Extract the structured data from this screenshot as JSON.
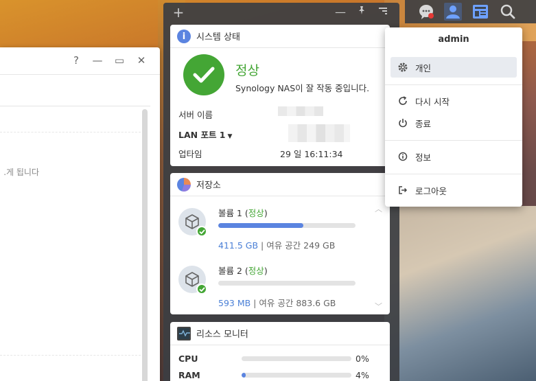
{
  "app_window": {
    "controls": {
      "help": "?",
      "minimize": "—",
      "maximize": "▭",
      "close": "✕"
    },
    "partial_text": "게 됩니다."
  },
  "widget_panel": {
    "toolbar": {
      "add": "+",
      "minimize": "—",
      "pin": "📌",
      "menu": "☰"
    },
    "system_status": {
      "title": "시스템 상태",
      "status": "정상",
      "description": "Synology NAS이 잘 작동 중입니다.",
      "server_name_label": "서버 이름",
      "lan_port_label": "LAN 포트 1",
      "uptime_label": "업타임",
      "uptime_value": "29 일 16:11:34"
    },
    "storage": {
      "title": "저장소",
      "volumes": [
        {
          "name": "볼륨 1",
          "state": "정상",
          "used": "411.5 GB",
          "free_label": "여유 공간",
          "free": "249 GB",
          "usage_fraction": 0.62
        },
        {
          "name": "볼륨 2",
          "state": "정상",
          "used": "593 MB",
          "free_label": "여유 공간",
          "free": "883.6 GB",
          "usage_fraction": 0.0
        }
      ]
    },
    "resource_monitor": {
      "title": "리소스 모니터",
      "rows": [
        {
          "label": "CPU",
          "value": "0%",
          "fraction": 0.0
        },
        {
          "label": "RAM",
          "value": "4%",
          "fraction": 0.04
        }
      ]
    }
  },
  "topbar": {
    "icons": [
      "chat-icon",
      "user-icon",
      "widget-icon",
      "search-icon"
    ]
  },
  "user_menu": {
    "username": "admin",
    "items": [
      {
        "label": "개인",
        "icon": "gear-icon"
      },
      {
        "label": "다시 시작",
        "icon": "restart-icon"
      },
      {
        "label": "종료",
        "icon": "power-icon"
      },
      {
        "label": "정보",
        "icon": "info-icon"
      },
      {
        "label": "로그아웃",
        "icon": "logout-icon"
      }
    ]
  },
  "colors": {
    "accent": "#5b84e0",
    "ok": "#44a635",
    "notification": "#e53935"
  }
}
